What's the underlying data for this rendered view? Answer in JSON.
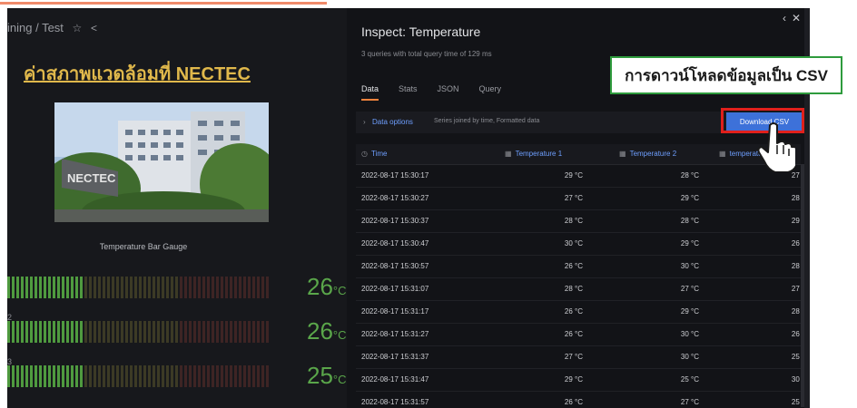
{
  "dashboard": {
    "breadcrumb": "ining / Test",
    "panel_title": "ค่าสภาพแวดล้อมที่ NECTEC",
    "photo_sign": "NECTEC",
    "gauge_title": "Temperature Bar Gauge",
    "gauges": [
      {
        "label": "",
        "value": "26",
        "unit": "°C"
      },
      {
        "label": "2",
        "value": "26",
        "unit": "°C"
      },
      {
        "label": "3",
        "value": "25",
        "unit": "°C"
      }
    ],
    "colors": {
      "value_green": "#5aa64a",
      "title_gold": "#e0b84b"
    }
  },
  "inspect": {
    "title": "Inspect: Temperature",
    "subtitle": "3 queries with total query time of 129 ms",
    "tabs": [
      "Data",
      "Stats",
      "JSON",
      "Query"
    ],
    "active_tab": "Data",
    "options_label": "Data options",
    "options_desc": "Series joined by time, Formatted data",
    "download_label": "Download CSV",
    "columns": [
      "Time",
      "Temperature 1",
      "Temperature 2",
      "temperature 3"
    ],
    "rows": [
      [
        "2022-08-17 15:30:17",
        "29 °C",
        "28 °C",
        "27 °C"
      ],
      [
        "2022-08-17 15:30:27",
        "27 °C",
        "29 °C",
        "28 °C"
      ],
      [
        "2022-08-17 15:30:37",
        "28 °C",
        "28 °C",
        "29 °C"
      ],
      [
        "2022-08-17 15:30:47",
        "30 °C",
        "29 °C",
        "26 °C"
      ],
      [
        "2022-08-17 15:30:57",
        "26 °C",
        "30 °C",
        "28 °C"
      ],
      [
        "2022-08-17 15:31:07",
        "28 °C",
        "27 °C",
        "27 °C"
      ],
      [
        "2022-08-17 15:31:17",
        "26 °C",
        "29 °C",
        "28 °C"
      ],
      [
        "2022-08-17 15:31:27",
        "26 °C",
        "30 °C",
        "26 °C"
      ],
      [
        "2022-08-17 15:31:37",
        "27 °C",
        "30 °C",
        "25 °C"
      ],
      [
        "2022-08-17 15:31:47",
        "29 °C",
        "25 °C",
        "30 °C"
      ],
      [
        "2022-08-17 15:31:57",
        "26 °C",
        "27 °C",
        "25 °C"
      ]
    ],
    "colors": {
      "accent_blue": "#3d71d9",
      "tab_underline": "#f0823d",
      "highlight_red": "#e0201c"
    }
  },
  "callout": {
    "text": "การดาวน์โหลดข้อมูลเป็น CSV",
    "border_color": "#2e9b3d"
  },
  "icons": [
    "star-icon",
    "share-icon",
    "chevron-left-icon",
    "close-icon",
    "clock-icon",
    "table-icon",
    "hand-pointer-icon"
  ]
}
